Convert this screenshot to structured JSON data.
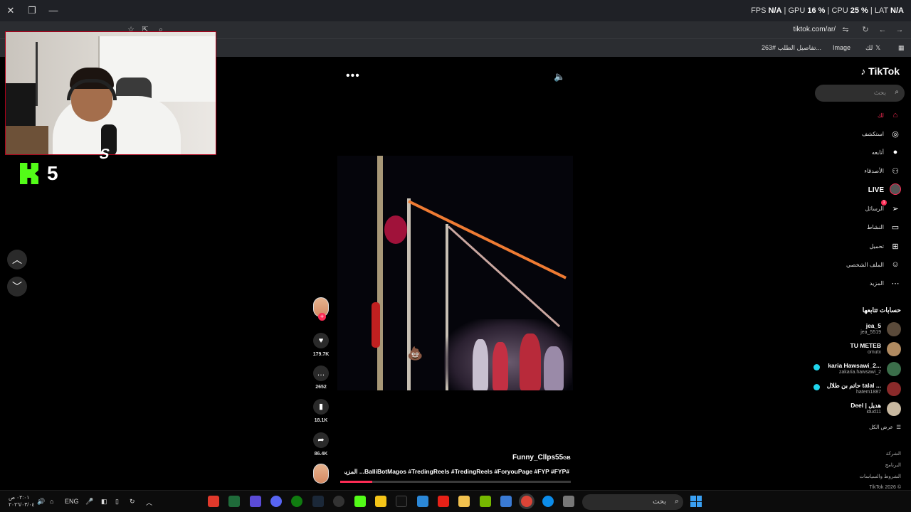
{
  "browser": {
    "perf": {
      "fps_label": "FPS",
      "fps": "N/A",
      "gpu_label": "GPU",
      "gpu": "16 %",
      "cpu_label": "CPU",
      "cpu": "25 %",
      "lat_label": "LAT",
      "lat": "N/A"
    },
    "url": "tiktok.com/ar/",
    "bookmarks": [
      "تفاصيل الطلب #263...",
      "Image",
      "لك"
    ]
  },
  "stream_overlay": {
    "kick_count": "5"
  },
  "video": {
    "author": "Funny_Cllps55",
    "author_suffix": "GB",
    "caption": "#BalliBotMagos #TredingReels #TredingReels #ForyouPage #FYP #FYP... المزيد",
    "progress_percent": 14,
    "likes": "179.7K",
    "comments": "2652",
    "saves": "18.1K",
    "shares": "86.4K"
  },
  "sidebar": {
    "brand": "TikTok",
    "search_placeholder": "بحث",
    "menu": [
      {
        "label": "لك",
        "icon": "home-icon",
        "glyph": "⌂",
        "active": true
      },
      {
        "label": "استكشف",
        "icon": "compass-icon",
        "glyph": "◎"
      },
      {
        "label": "أتابعه",
        "icon": "following-icon",
        "glyph": "●"
      },
      {
        "label": "الأصدقاء",
        "icon": "friends-icon",
        "glyph": "⚇"
      },
      {
        "label": "LIVE",
        "icon": "live-icon",
        "glyph": ""
      },
      {
        "label": "الرسائل",
        "icon": "messages-icon",
        "glyph": "➢",
        "badge": "1"
      },
      {
        "label": "النشاط",
        "icon": "activity-icon",
        "glyph": "▭"
      },
      {
        "label": "تحميل",
        "icon": "upload-icon",
        "glyph": "⊞"
      },
      {
        "label": "الملف الشخصي",
        "icon": "profile-icon",
        "glyph": "☺"
      },
      {
        "label": "المزيد",
        "icon": "more-icon",
        "glyph": "⋯"
      }
    ],
    "following_title": "حسابات تتابعها",
    "accounts": [
      {
        "name": "jea_5",
        "handle": "jea_5519",
        "live": false,
        "color": "#5a4a3a"
      },
      {
        "name": "TU METEB",
        "handle": "omutx",
        "live": false,
        "color": "#b08a60"
      },
      {
        "name": "karia Hawsawi_2...",
        "handle": "zakaria.hawsawi_2",
        "live": true,
        "color": "#3b6e4a"
      },
      {
        "name": "حاتم بن طلال talal ...",
        "handle": "hatem1887",
        "live": true,
        "color": "#8a2a2a"
      },
      {
        "name": "Deel | هديل",
        "handle": "idud11",
        "live": false,
        "color": "#c8b8a0"
      }
    ],
    "see_all": "عرض الكل",
    "footer": [
      "الشركة",
      "البرنامج",
      "الشروط والسياسات",
      "TikTok 2026 ©"
    ]
  },
  "taskbar": {
    "clock_time": "٠٢:٠١ ص",
    "clock_date": "٢٠٢٦/٠٣/٠٤",
    "lang": "ENG",
    "search_placeholder": "بحث"
  }
}
